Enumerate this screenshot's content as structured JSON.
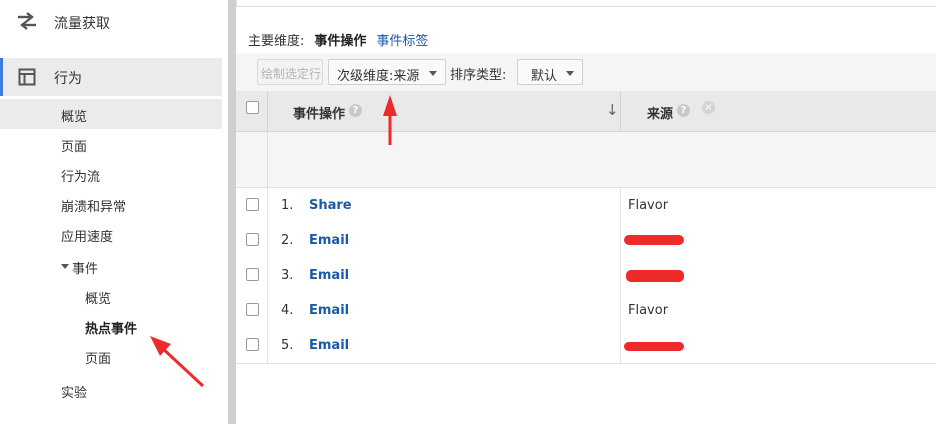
{
  "sidebar": {
    "acquisition_label": "流量获取",
    "behavior_label": "行为",
    "items": [
      {
        "label": "概览"
      },
      {
        "label": "页面"
      },
      {
        "label": "行为流"
      },
      {
        "label": "崩溃和异常"
      },
      {
        "label": "应用速度"
      },
      {
        "label": "事件"
      }
    ],
    "event_items": [
      {
        "label": "概览"
      },
      {
        "label": "热点事件"
      },
      {
        "label": "页面"
      }
    ],
    "experiments_label": "实验"
  },
  "main": {
    "primary_dim_label": "主要维度:",
    "primary_dim_active": "事件操作",
    "primary_dim_link": "事件标签",
    "plot_rows_label": "绘制选定行",
    "secondary_dim_label": "次级维度:来源",
    "sort_type_label": "排序类型:",
    "sort_value": "默认",
    "table": {
      "columns": [
        "事件操作",
        "来源"
      ],
      "rows": [
        {
          "index": "1.",
          "event": "Share",
          "source": "Flavor",
          "redacted": false
        },
        {
          "index": "2.",
          "event": "Email",
          "source": "",
          "redacted": true
        },
        {
          "index": "3.",
          "event": "Email",
          "source": "",
          "redacted": true
        },
        {
          "index": "4.",
          "event": "Email",
          "source": "Flavor",
          "redacted": false
        },
        {
          "index": "5.",
          "event": "Email",
          "source": "",
          "redacted": true
        }
      ]
    }
  },
  "colors": {
    "accent": "#3b7ddd",
    "link": "#1a5aa8",
    "annotation_red": "#ee2a2a"
  }
}
